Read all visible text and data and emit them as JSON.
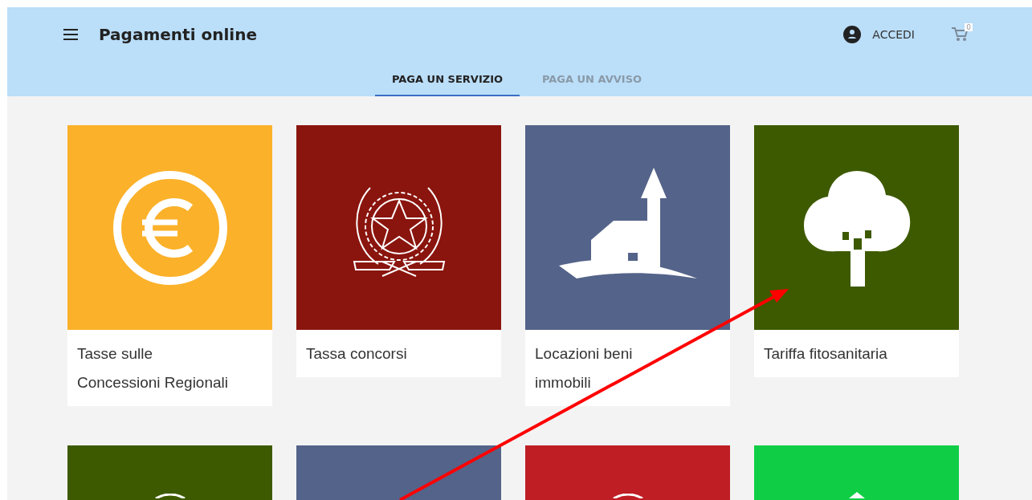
{
  "header": {
    "title": "Pagamenti online",
    "login": "ACCEDI",
    "cart_count": "0"
  },
  "tabs": [
    {
      "label": "PAGA UN SERVIZIO",
      "selected": true
    },
    {
      "label": "PAGA UN AVVISO",
      "selected": false
    }
  ],
  "services": [
    {
      "title": "Tasse sulle Concessioni Regionali",
      "color": "#fbb12a",
      "kind": "euro"
    },
    {
      "title": "Tassa concorsi",
      "color": "#8a150e",
      "kind": "emblem"
    },
    {
      "title": "Locazioni beni immobili",
      "color": "#546389",
      "kind": "house"
    },
    {
      "title": "Tariffa fitosanitaria",
      "color": "#3d5a00",
      "kind": "tree"
    },
    {
      "color": "#3d5a00",
      "kind": "bump"
    },
    {
      "color": "#546389",
      "kind": "none"
    },
    {
      "color": "#be1e24",
      "kind": "bump"
    },
    {
      "color": "#0fce45",
      "kind": "peak"
    }
  ]
}
